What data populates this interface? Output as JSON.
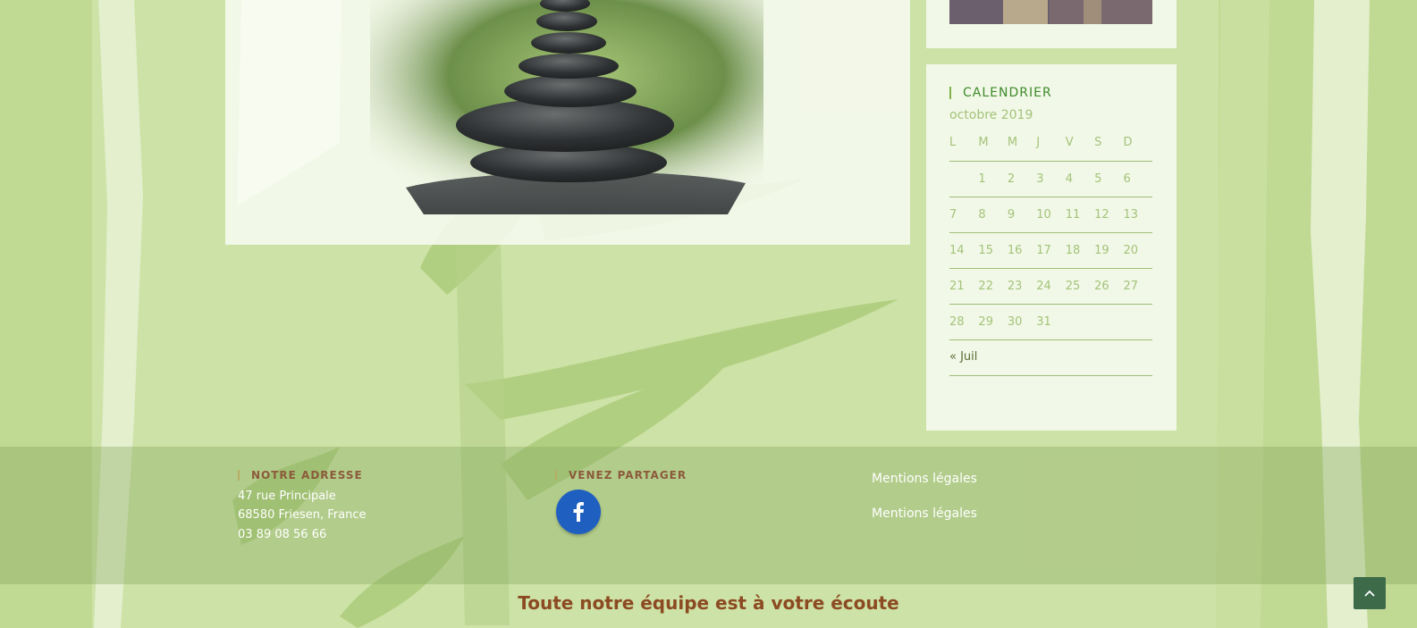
{
  "colors": {
    "background": "#c0d993",
    "panel": "#f7faf0",
    "accent_green": "#3f8a2c",
    "calendar_text": "#a3c37a",
    "footer_title": "#8c5a3c",
    "tagline": "#8c4a22",
    "facebook": "#1f5fc0",
    "scroll_button": "#3d6b4a"
  },
  "calendar": {
    "title": "CALENDRIER",
    "caption": "octobre 2019",
    "weekdays": [
      "L",
      "M",
      "M",
      "J",
      "V",
      "S",
      "D"
    ],
    "weeks": [
      [
        "",
        "1",
        "2",
        "3",
        "4",
        "5",
        "6"
      ],
      [
        "7",
        "8",
        "9",
        "10",
        "11",
        "12",
        "13"
      ],
      [
        "14",
        "15",
        "16",
        "17",
        "18",
        "19",
        "20"
      ],
      [
        "21",
        "22",
        "23",
        "24",
        "25",
        "26",
        "27"
      ],
      [
        "28",
        "29",
        "30",
        "31",
        "",
        "",
        ""
      ]
    ],
    "prev_link": "« Juil"
  },
  "footer": {
    "address_title": "NOTRE ADRESSE",
    "address_lines": [
      "47 rue Principale",
      "68580 Friesen, France",
      "03 89 08 56 66"
    ],
    "share_title": "VENEZ PARTAGER",
    "facebook_icon": "facebook-icon",
    "legal_links": [
      "Mentions légales",
      "Mentions légales"
    ],
    "tagline": "Toute notre équipe est à votre écoute"
  },
  "icons": {
    "scroll_top": "chevron-up-icon"
  }
}
